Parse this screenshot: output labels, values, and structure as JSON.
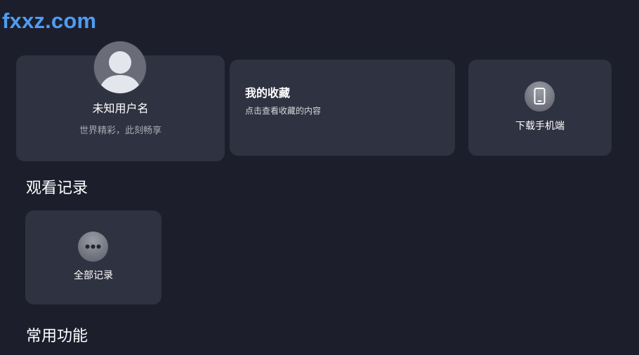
{
  "watermark": "fxxz.com",
  "profile": {
    "username": "未知用户名",
    "slogan": "世界精彩，此刻畅享"
  },
  "favorites": {
    "title": "我的收藏",
    "subtitle": "点击查看收藏的内容"
  },
  "download": {
    "label": "下载手机端",
    "icon": "phone-icon"
  },
  "history": {
    "title": "观看记录",
    "all_label": "全部记录",
    "icon": "more-dots-icon"
  },
  "common": {
    "title": "常用功能"
  },
  "colors": {
    "background": "#1d1e2c",
    "card": "#2f3240",
    "watermark": "#4f9cf0",
    "secondary_text": "#a7a9b3"
  }
}
